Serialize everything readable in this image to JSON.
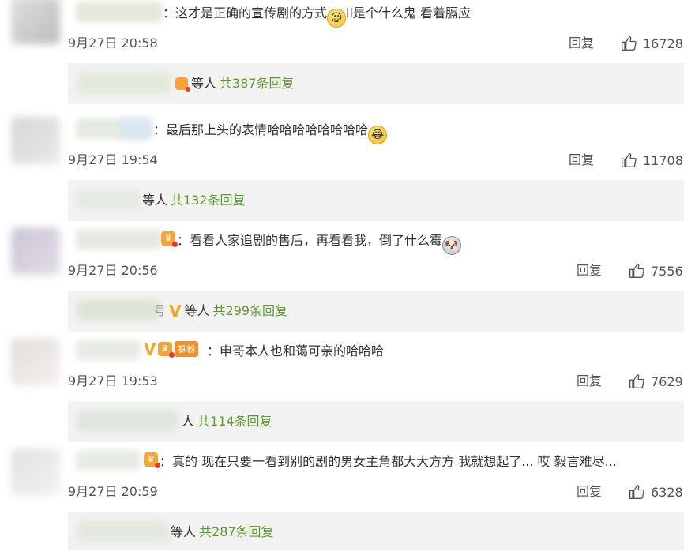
{
  "comments": [
    {
      "separator": "：",
      "text": "这才是正确的宣传剧的方式",
      "text_after_emoji": "ll是个什么鬼 看着膈应",
      "emoji": "smile-emoji",
      "time": "9月27日 20:58",
      "reply_label": "回复",
      "likes": "16728",
      "reply_suffix": "等人",
      "reply_count": "共387条回复"
    },
    {
      "separator": "：",
      "text": "最后那上头的表情哈哈哈哈哈哈哈哈",
      "emoji": "laugh-emoji",
      "time": "9月27日 19:54",
      "reply_label": "回复",
      "likes": "11708",
      "reply_suffix": "等人",
      "reply_count": "共132条回复"
    },
    {
      "separator": "：",
      "text": "看看人家追剧的售后，再看看我，倒了什么霉",
      "emoji": "dog-emoji",
      "time": "9月27日 20:56",
      "reply_label": "回复",
      "likes": "7556",
      "reply_name_tail": "号",
      "reply_suffix": "等人",
      "reply_count": "共299条回复"
    },
    {
      "separator": "：",
      "fan_tag": "铁粉",
      "text": "申哥本人也和蔼可亲的哈哈哈",
      "time": "9月27日 19:53",
      "reply_label": "回复",
      "likes": "7629",
      "reply_suffix": "人",
      "reply_count": "共114条回复"
    },
    {
      "separator": "：",
      "text": "真的 现在只要一看到别的剧的男女主角都大大方方 我就想起了... 哎 毅言难尽...",
      "time": "9月27日 20:59",
      "reply_label": "回复",
      "likes": "6328",
      "reply_suffix": "等人",
      "reply_count": "共287条回复"
    }
  ],
  "icons": {
    "vip": "V",
    "crown": "♛"
  },
  "colors": {
    "reply_count": "#5f9a2e",
    "vip_badge": "#f5a623",
    "fan_tag": "#f0902a",
    "reply_bg": "#f2f2f2"
  }
}
